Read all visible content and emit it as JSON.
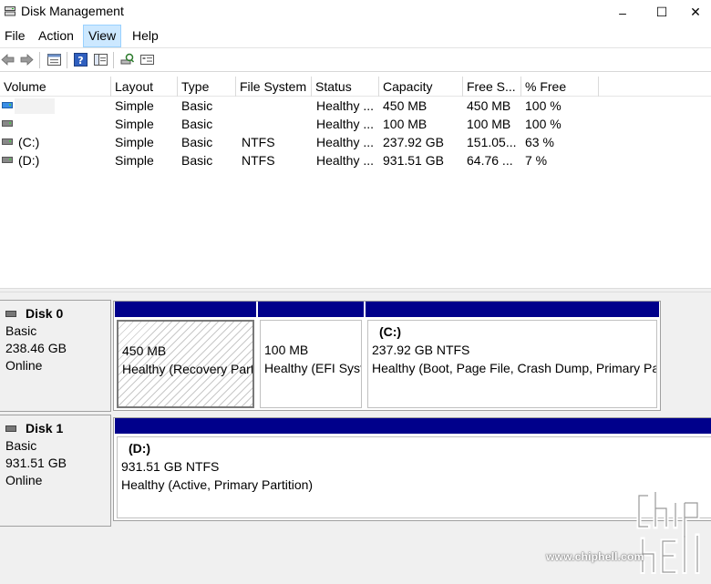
{
  "window": {
    "title": "Disk Management",
    "controls": {
      "minimize": "–",
      "maximize": "☐",
      "close": "✕"
    }
  },
  "menu": {
    "items": [
      {
        "label": "File"
      },
      {
        "label": "Action"
      },
      {
        "label": "View",
        "active": true
      },
      {
        "label": "Help"
      }
    ]
  },
  "toolbar": {
    "buttons": [
      "back-icon",
      "forward-icon",
      "properties-icon",
      "help-icon",
      "console-icon",
      "rescan-icon",
      "disk-list-icon"
    ]
  },
  "volume_list": {
    "columns": [
      "Volume",
      "Layout",
      "Type",
      "File System",
      "Status",
      "Capacity",
      "Free S...",
      "% Free"
    ],
    "rows": [
      {
        "volume": "",
        "layout": "Simple",
        "type": "Basic",
        "fs": "",
        "status": "Healthy ...",
        "capacity": "450 MB",
        "free": "450 MB",
        "pct": "100 %"
      },
      {
        "volume": "",
        "layout": "Simple",
        "type": "Basic",
        "fs": "",
        "status": "Healthy ...",
        "capacity": "100 MB",
        "free": "100 MB",
        "pct": "100 %"
      },
      {
        "volume": "(C:)",
        "layout": "Simple",
        "type": "Basic",
        "fs": "NTFS",
        "status": "Healthy ...",
        "capacity": "237.92 GB",
        "free": "151.05...",
        "pct": "63 %"
      },
      {
        "volume": "(D:)",
        "layout": "Simple",
        "type": "Basic",
        "fs": "NTFS",
        "status": "Healthy ...",
        "capacity": "931.51 GB",
        "free": "64.76 ...",
        "pct": "7 %"
      }
    ]
  },
  "disks": [
    {
      "name": "Disk 0",
      "type": "Basic",
      "size": "238.46 GB",
      "status": "Online",
      "partitions": [
        {
          "name": "",
          "size": "450 MB",
          "status": "Healthy (Recovery Partition)"
        },
        {
          "name": "",
          "size": "100 MB",
          "status": "Healthy (EFI System Partition)"
        },
        {
          "name": "(C:)",
          "size": "237.92 GB NTFS",
          "status": "Healthy (Boot, Page File, Crash Dump, Primary Partition)"
        }
      ]
    },
    {
      "name": "Disk 1",
      "type": "Basic",
      "size": "931.51 GB",
      "status": "Online",
      "partitions": [
        {
          "name": "(D:)",
          "size": "931.51 GB NTFS",
          "status": "Healthy (Active, Primary Partition)"
        }
      ]
    }
  ],
  "watermark": {
    "text": "www.chiphell.com",
    "logo": "chiphell-logo"
  }
}
